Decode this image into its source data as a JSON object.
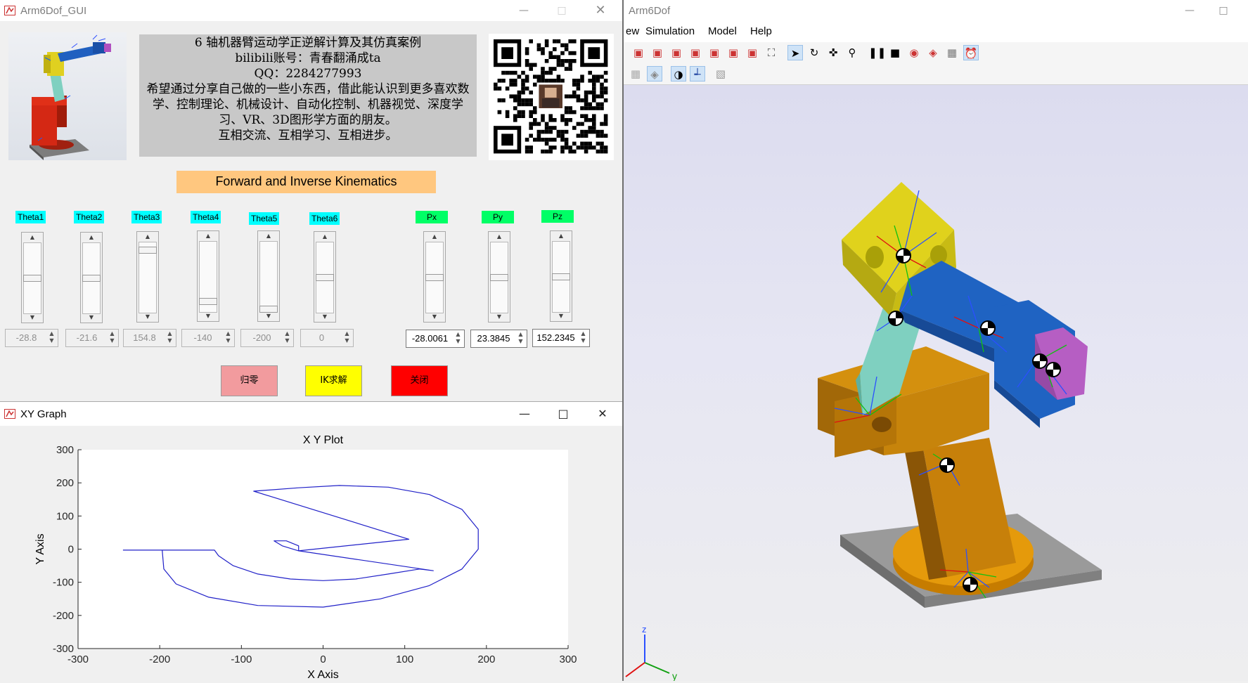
{
  "gui": {
    "title": "Arm6Dof_GUI",
    "info_lines": [
      "6 轴机器臂运动学正逆解计算及其仿真案例",
      "bilibili账号：青春翻涌成ta",
      "QQ：2284277993",
      "希望通过分享自己做的一些小东西，借此能认识到更多喜欢数学、控制理论、机械设计、自动化控制、机器视觉、深度学习、VR、3D图形学方面的朋友。",
      "互相交流、互相学习、互相进步。"
    ],
    "section_title": "Forward and Inverse Kinematics",
    "joints": [
      {
        "label": "Theta1",
        "value": "-28.8",
        "level": 0.5
      },
      {
        "label": "Theta2",
        "value": "-21.6",
        "level": 0.5
      },
      {
        "label": "Theta3",
        "value": "154.8",
        "level": 0.92
      },
      {
        "label": "Theta4",
        "value": "-140",
        "level": 0.12
      },
      {
        "label": "Theta5",
        "value": "-200",
        "level": 0.0
      },
      {
        "label": "Theta6",
        "value": "0",
        "level": 0.5
      }
    ],
    "positions": [
      {
        "label": "Px",
        "value": "-28.0061",
        "level": 0.5
      },
      {
        "label": "Py",
        "value": "23.3845",
        "level": 0.5
      },
      {
        "label": "Pz",
        "value": "152.2345",
        "level": 0.5
      }
    ],
    "buttons": {
      "home": "归零",
      "ik_solve": "IK求解",
      "close": "关闭"
    },
    "colors": {
      "joint_label_bg": "#00ffff",
      "pos_label_bg": "#00ff66",
      "title_bg": "#ffc77f",
      "home_bg": "#f29b9e",
      "ik_bg": "#ffff00",
      "close_bg": "#ff0000"
    }
  },
  "xy_graph": {
    "window_title": "XY Graph",
    "chart_data": {
      "type": "line",
      "title": "X Y Plot",
      "xlabel": "X Axis",
      "ylabel": "Y Axis",
      "xlim": [
        -300,
        300
      ],
      "ylim": [
        -300,
        300
      ],
      "xticks": [
        -300,
        -200,
        -100,
        0,
        100,
        200,
        300
      ],
      "yticks": [
        300,
        200,
        100,
        0,
        -100,
        -200,
        -300
      ],
      "series": [
        {
          "color": "#2020c8",
          "points": [
            [
              -245,
              -3
            ],
            [
              -195,
              -3
            ],
            [
              -133,
              -3
            ],
            [
              -128,
              -20
            ],
            [
              -110,
              -50
            ],
            [
              -80,
              -75
            ],
            [
              -40,
              -90
            ],
            [
              0,
              -95
            ],
            [
              40,
              -90
            ],
            [
              80,
              -75
            ],
            [
              118,
              -60
            ],
            [
              135,
              -65
            ],
            [
              -30,
              -5
            ],
            [
              -50,
              10
            ],
            [
              -60,
              25
            ],
            [
              -45,
              25
            ],
            [
              -30,
              10
            ],
            [
              -30,
              -5
            ],
            [
              105,
              30
            ],
            [
              -85,
              175
            ],
            [
              -30,
              185
            ],
            [
              20,
              192
            ],
            [
              80,
              187
            ],
            [
              130,
              165
            ],
            [
              170,
              120
            ],
            [
              190,
              60
            ],
            [
              190,
              0
            ],
            [
              170,
              -60
            ],
            [
              130,
              -110
            ],
            [
              70,
              -150
            ],
            [
              0,
              -175
            ],
            [
              -80,
              -170
            ],
            [
              -140,
              -145
            ],
            [
              -180,
              -105
            ],
            [
              -195,
              -60
            ],
            [
              -197,
              -3
            ]
          ]
        }
      ]
    }
  },
  "sim": {
    "title": "Arm6Dof",
    "menu": [
      "ew",
      "Simulation",
      "Model",
      "Help"
    ],
    "axis_labels": {
      "z": "z",
      "y": "y"
    }
  }
}
